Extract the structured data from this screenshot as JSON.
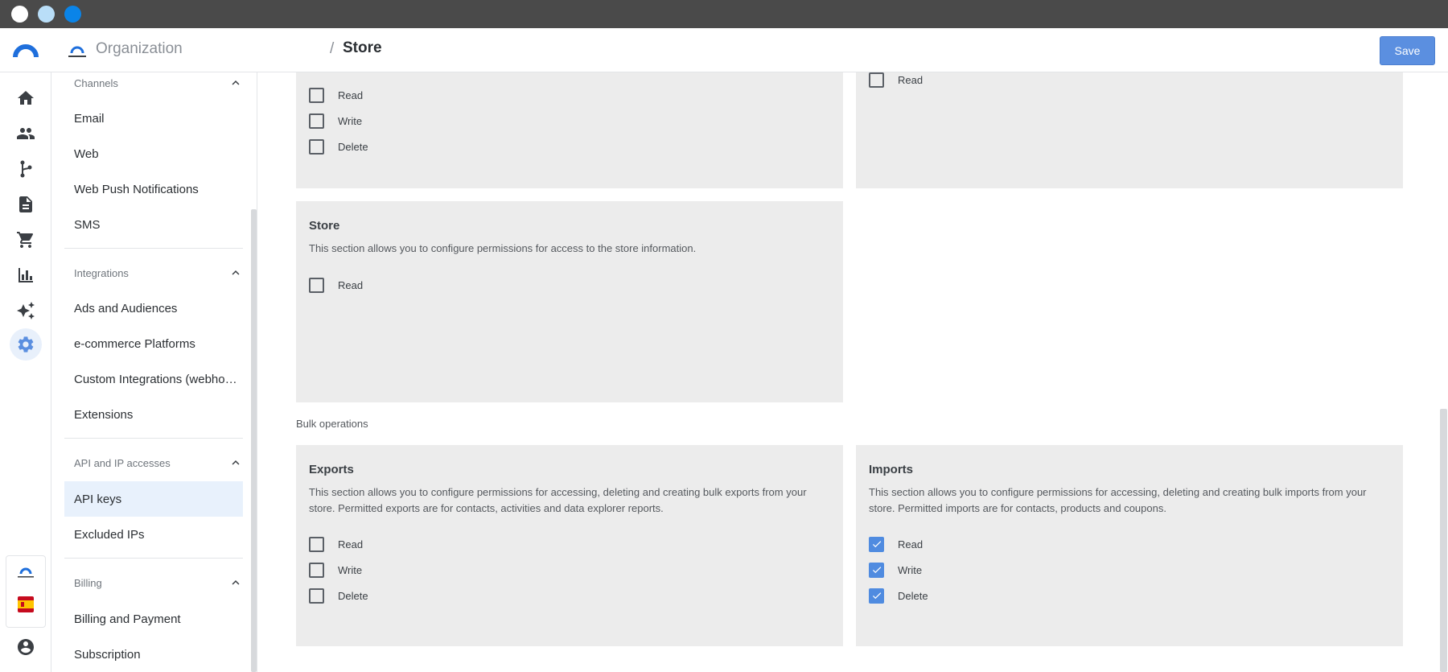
{
  "window": {
    "dots": [
      "#ffffff",
      "#b9def8",
      "#0a84e8"
    ]
  },
  "header": {
    "org_name": "Organization",
    "separator": "/",
    "page_title": "Store",
    "save_label": "Save"
  },
  "rail": {
    "icons": [
      "home-icon",
      "people-icon",
      "flow-icon",
      "document-icon",
      "cart-icon",
      "chart-icon",
      "sparkle-icon",
      "gear-icon"
    ],
    "active": "gear-icon"
  },
  "sidenav": {
    "sections": [
      {
        "title": "Channels",
        "items": [
          "Email",
          "Web",
          "Web Push Notifications",
          "SMS"
        ]
      },
      {
        "title": "Integrations",
        "items": [
          "Ads and Audiences",
          "e-commerce Platforms",
          "Custom Integrations (webhooks)",
          "Extensions"
        ]
      },
      {
        "title": "API and IP accesses",
        "items": [
          "API keys",
          "Excluded IPs"
        ]
      },
      {
        "title": "Billing",
        "items": [
          "Billing and Payment",
          "Subscription"
        ]
      }
    ],
    "active_item": "API keys"
  },
  "main": {
    "top_left_card": {
      "perms": [
        {
          "label": "Read",
          "checked": false
        },
        {
          "label": "Write",
          "checked": false
        },
        {
          "label": "Delete",
          "checked": false
        }
      ]
    },
    "top_right_card": {
      "perms": [
        {
          "label": "Read",
          "checked": false
        }
      ]
    },
    "store_card": {
      "title": "Store",
      "description": "This section allows you to configure permissions for access to the store information.",
      "perms": [
        {
          "label": "Read",
          "checked": false
        }
      ]
    },
    "bulk_section_label": "Bulk operations",
    "exports_card": {
      "title": "Exports",
      "description": "This section allows you to configure permissions for accessing, deleting and creating bulk exports from your store. Permitted exports are for contacts, activities and data explorer reports.",
      "perms": [
        {
          "label": "Read",
          "checked": false
        },
        {
          "label": "Write",
          "checked": false
        },
        {
          "label": "Delete",
          "checked": false
        }
      ]
    },
    "imports_card": {
      "title": "Imports",
      "description": "This section allows you to configure permissions for accessing, deleting and creating bulk imports from your store. Permitted imports are for contacts, products and coupons.",
      "perms": [
        {
          "label": "Read",
          "checked": true
        },
        {
          "label": "Write",
          "checked": true
        },
        {
          "label": "Delete",
          "checked": true
        }
      ]
    }
  }
}
